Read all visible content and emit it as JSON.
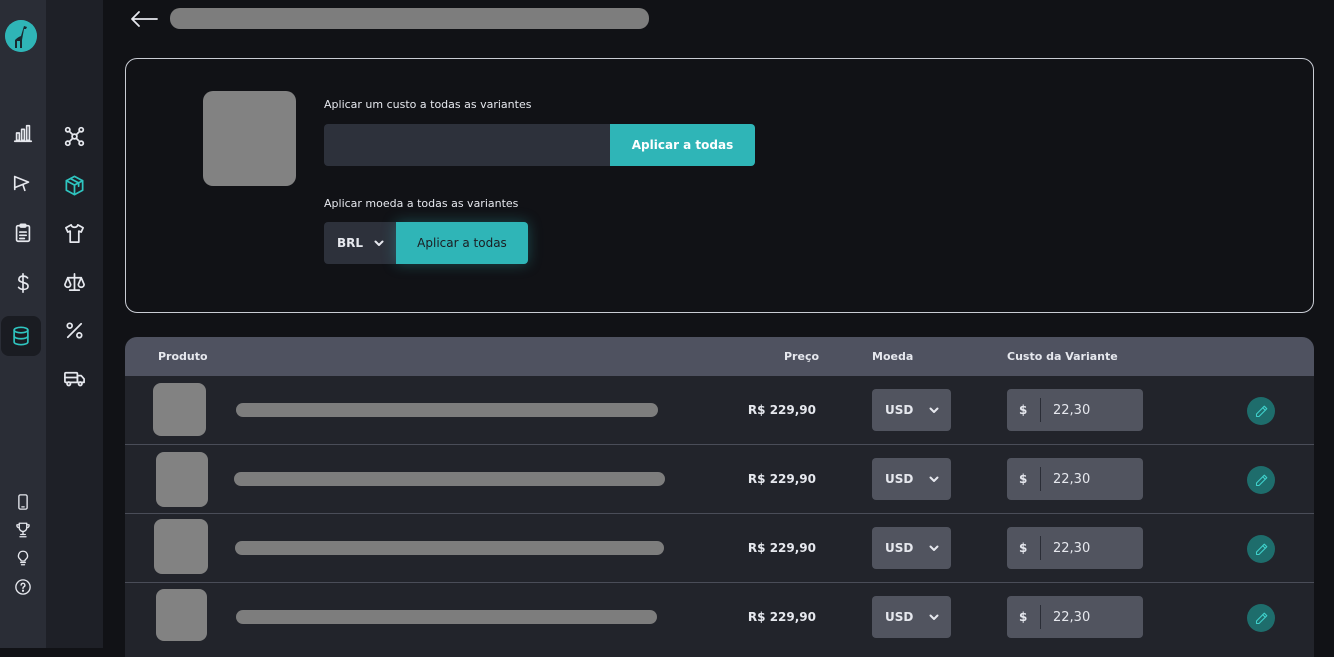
{
  "bulk": {
    "cost_label": "Aplicar um custo a todas as variantes",
    "cost_value": "",
    "apply_cost_button": "Aplicar a todas",
    "currency_label": "Aplicar moeda a todas as variantes",
    "currency_selected": "BRL",
    "apply_currency_button": "Aplicar a todas"
  },
  "table": {
    "headers": {
      "product": "Produto",
      "price": "Preço",
      "currency": "Moeda",
      "variant_cost": "Custo da Variante"
    },
    "rows": [
      {
        "price": "R$ 229,90",
        "currency": "USD",
        "cost_symbol": "$",
        "cost": "22,30"
      },
      {
        "price": "R$ 229,90",
        "currency": "USD",
        "cost_symbol": "$",
        "cost": "22,30"
      },
      {
        "price": "R$ 229,90",
        "currency": "USD",
        "cost_symbol": "$",
        "cost": "22,30"
      },
      {
        "price": "R$ 229,90",
        "currency": "USD",
        "cost_symbol": "$",
        "cost": "22,30"
      }
    ]
  },
  "icons": {
    "rail": [
      "bar-chart-icon",
      "megaphone-icon",
      "clipboard-icon",
      "dollar-icon",
      "database-icon",
      "smartphone-icon",
      "trophy-icon",
      "lightbulb-icon",
      "help-icon"
    ],
    "subnav": [
      "integrations-icon",
      "package-icon",
      "tshirt-icon",
      "scale-icon",
      "percent-icon",
      "truck-icon"
    ]
  },
  "colors": {
    "accent": "#2fb5b7",
    "active_icon": "#2fc5c0"
  }
}
